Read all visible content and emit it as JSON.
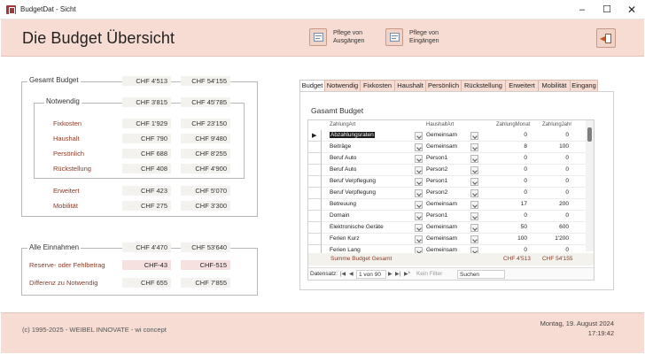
{
  "window": {
    "title": "BudgetDat - Sicht",
    "min": "–",
    "max": "☐",
    "close": "✕"
  },
  "header": {
    "title": "Die Budget Übersicht",
    "btn_ausgaben": "Pflege von\nAusgängen",
    "btn_eingaben": "Pflege von\nEingängen"
  },
  "left": {
    "gesamt": {
      "label": "Gesamt Budget",
      "monat": "CHF 4'513",
      "jahr": "CHF 54'155"
    },
    "notwendig": {
      "label": "Notwendig",
      "monat": "CHF 3'815",
      "jahr": "CHF 45'785"
    },
    "items": [
      {
        "label": "Fixkosten",
        "monat": "CHF 1'929",
        "jahr": "CHF 23'150"
      },
      {
        "label": "Haushalt",
        "monat": "CHF 790",
        "jahr": "CHF 9'480"
      },
      {
        "label": "Persönlich",
        "monat": "CHF 688",
        "jahr": "CHF 8'255"
      },
      {
        "label": "Rückstellung",
        "monat": "CHF 408",
        "jahr": "CHF 4'900"
      }
    ],
    "extra": [
      {
        "label": "Erweitert",
        "monat": "CHF 423",
        "jahr": "CHF 5'070"
      },
      {
        "label": "Mobilität",
        "monat": "CHF 275",
        "jahr": "CHF 3'300"
      }
    ],
    "einnahmen": {
      "label": "Alle Einnahmen",
      "monat": "CHF 4'470",
      "jahr": "CHF 53'640"
    },
    "reserve": {
      "label": "Reserve- oder Fehlbetrag",
      "monat": "CHF-43",
      "jahr": "CHF-515"
    },
    "differenz": {
      "label": "Differenz zu Notwendig",
      "monat": "CHF 655",
      "jahr": "CHF 7'855"
    }
  },
  "tabs": [
    "Budget",
    "Notwendig",
    "Fixkosten",
    "Haushalt",
    "Persönlich",
    "Rückstellung",
    "Erweitert",
    "Mobilität",
    "Eingang"
  ],
  "panel": {
    "title": "Gasamt Budget",
    "columns": {
      "art": "ZahlungArt",
      "haushalt": "HaushaltArt",
      "monat": "ZahlungMonat",
      "jahr": "ZahlungJahr"
    },
    "rows": [
      {
        "art": "Abzahlungsraten",
        "haushalt": "Gemeinsam",
        "monat": "0",
        "jahr": "0"
      },
      {
        "art": "Beiträge",
        "haushalt": "Gemeinsam",
        "monat": "8",
        "jahr": "100"
      },
      {
        "art": "Beruf Auto",
        "haushalt": "Person1",
        "monat": "0",
        "jahr": "0"
      },
      {
        "art": "Beruf Auto",
        "haushalt": "Person2",
        "monat": "0",
        "jahr": "0"
      },
      {
        "art": "Beruf Verpflegung",
        "haushalt": "Person1",
        "monat": "0",
        "jahr": "0"
      },
      {
        "art": "Beruf Verpflegung",
        "haushalt": "Person2",
        "monat": "0",
        "jahr": "0"
      },
      {
        "art": "Betreuung",
        "haushalt": "Gemeinsam",
        "monat": "17",
        "jahr": "200"
      },
      {
        "art": "Domain",
        "haushalt": "Person1",
        "monat": "0",
        "jahr": "0"
      },
      {
        "art": "Elektronische Geräte",
        "haushalt": "Gemeinsam",
        "monat": "50",
        "jahr": "600"
      },
      {
        "art": "Ferien Kurz",
        "haushalt": "Gemeinsam",
        "monat": "100",
        "jahr": "1'200"
      },
      {
        "art": "Ferien Lang",
        "haushalt": "Gemeinsam",
        "monat": "0",
        "jahr": "0"
      }
    ],
    "sum_label": "Summe Budget Gesamt",
    "sum_monat": "CHF 4'513",
    "sum_jahr": "CHF 54'155",
    "nav": {
      "label": "Datensatz:",
      "position": "1 von 90",
      "filter": "Kein Filter",
      "search": "Suchen"
    }
  },
  "footer": {
    "copyright": "(c) 1995-2025 - WEIBEL INNOVATE - wi concept",
    "date": "Montag, 19. August 2024",
    "time": "17:19:42"
  },
  "colors": {
    "accent": "#f6dcd2",
    "brand": "#8a3a25",
    "negative_bg": "#f7e0e0"
  }
}
